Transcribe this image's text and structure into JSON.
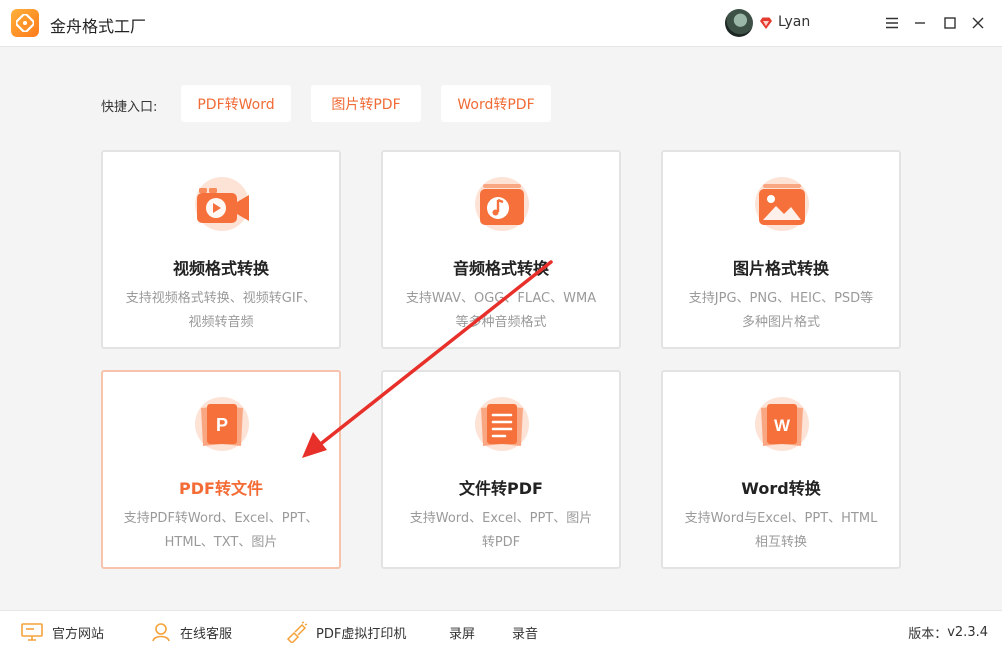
{
  "app": {
    "title": "金舟格式工厂",
    "username": "Lyan",
    "version_label": "版本：",
    "version": "v2.3.4"
  },
  "quick": {
    "label": "快捷入口:",
    "buttons": [
      "PDF转Word",
      "图片转PDF",
      "Word转PDF"
    ]
  },
  "cards": [
    {
      "title": "视频格式转换",
      "desc1": "支持视频格式转换、视频转GIF、",
      "desc2": "视频转音频",
      "icon": "video-icon"
    },
    {
      "title": "音频格式转换",
      "desc1": "支持WAV、OGG、FLAC、WMA",
      "desc2": "等多种音频格式",
      "icon": "music-icon"
    },
    {
      "title": "图片格式转换",
      "desc1": "支持JPG、PNG、HEIC、PSD等",
      "desc2": "多种图片格式",
      "icon": "image-icon"
    },
    {
      "title": "PDF转文件",
      "desc1": "支持PDF转Word、Excel、PPT、",
      "desc2": "HTML、TXT、图片",
      "icon": "pdf-p-icon",
      "active": true
    },
    {
      "title": "文件转PDF",
      "desc1": "支持Word、Excel、PPT、图片",
      "desc2": "转PDF",
      "icon": "document-icon"
    },
    {
      "title": "Word转换",
      "desc1": "支持Word与Excel、PPT、HTML",
      "desc2": "相互转换",
      "icon": "word-w-icon"
    }
  ],
  "footer": {
    "items": [
      "官方网站",
      "在线客服",
      "PDF虚拟打印机",
      "录屏",
      "录音"
    ]
  },
  "colors": {
    "accent": "#f36b35",
    "card_border_active": "#f6c3ad",
    "annotation_arrow": "#e8302a"
  }
}
